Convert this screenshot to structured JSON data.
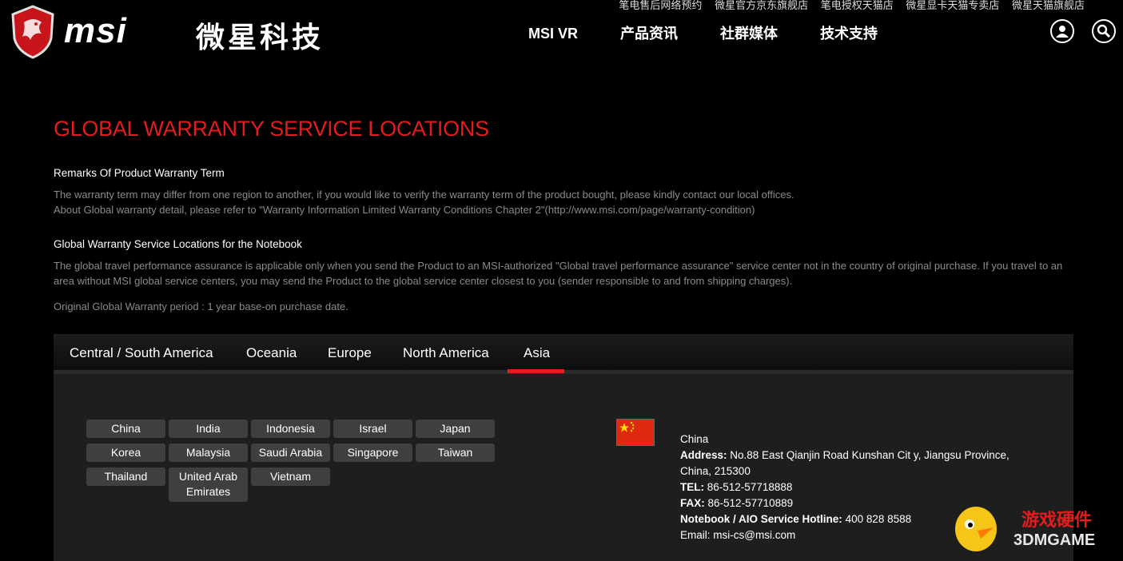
{
  "header": {
    "top_links": [
      "笔电售后网络预约",
      "微星官方京东旗舰店",
      "笔电授权天猫店",
      "微星显卡天猫专卖店",
      "微星天猫旗舰店"
    ],
    "logo_text": "msi",
    "logo_cn": "微星科技",
    "nav": [
      "MSI VR",
      "产品资讯",
      "社群媒体",
      "技术支持"
    ],
    "icons": [
      "user-icon",
      "search-icon"
    ]
  },
  "page": {
    "title": "GLOBAL WARRANTY SERVICE LOCATIONS",
    "remarks_title": "Remarks Of Product Warranty Term",
    "remarks_line1": "The warranty term may differ from one region to another, if you would like to verify the warranty term of the product bought, please kindly contact our local offices.",
    "remarks_line2": "About Global warranty detail, please refer to \"Warranty Information Limited Warranty Conditions Chapter 2\"(http://www.msi.com/page/warranty-condition)",
    "notebook_title": "Global Warranty Service Locations for the Notebook",
    "notebook_body": "The global travel performance assurance is applicable only when you send the Product to an MSI-authorized \"Global travel performance assurance\" service center not in the country of original purchase. If you travel to an area without MSI global service centers, you may send the Product to the global service center closest to you (sender responsible to and from shipping charges).",
    "period": "Original Global Warranty period : 1 year base-on purchase date."
  },
  "tabs": {
    "items": [
      "Central / South America",
      "Oceania",
      "Europe",
      "North America",
      "Asia"
    ],
    "active": "Asia"
  },
  "countries": [
    "China",
    "India",
    "Indonesia",
    "Israel",
    "Japan",
    "Korea",
    "Malaysia",
    "Saudi Arabia",
    "Singapore",
    "Taiwan",
    "Thailand",
    "United Arab Emirates",
    "Vietnam"
  ],
  "selected": {
    "name": "China",
    "address_label": "Address:",
    "address": "No.88 East Qianjin Road Kunshan Cit y, Jiangsu Province, China, 215300",
    "tel_label": "TEL:",
    "tel": "86-512-57718888",
    "fax_label": "FAX:",
    "fax": "86-512-57710889",
    "hotline_label": "Notebook / AIO Service Hotline:",
    "hotline": "400 828 8588",
    "email_label": "Email:",
    "email": "msi-cs@msi.com"
  },
  "watermark": {
    "cn": "游戏硬件",
    "en": "3DMGAME"
  },
  "colors": {
    "accent": "#e51c1c",
    "background": "#000000",
    "panel": "#1e1e1e",
    "button": "#3f3f3f"
  }
}
